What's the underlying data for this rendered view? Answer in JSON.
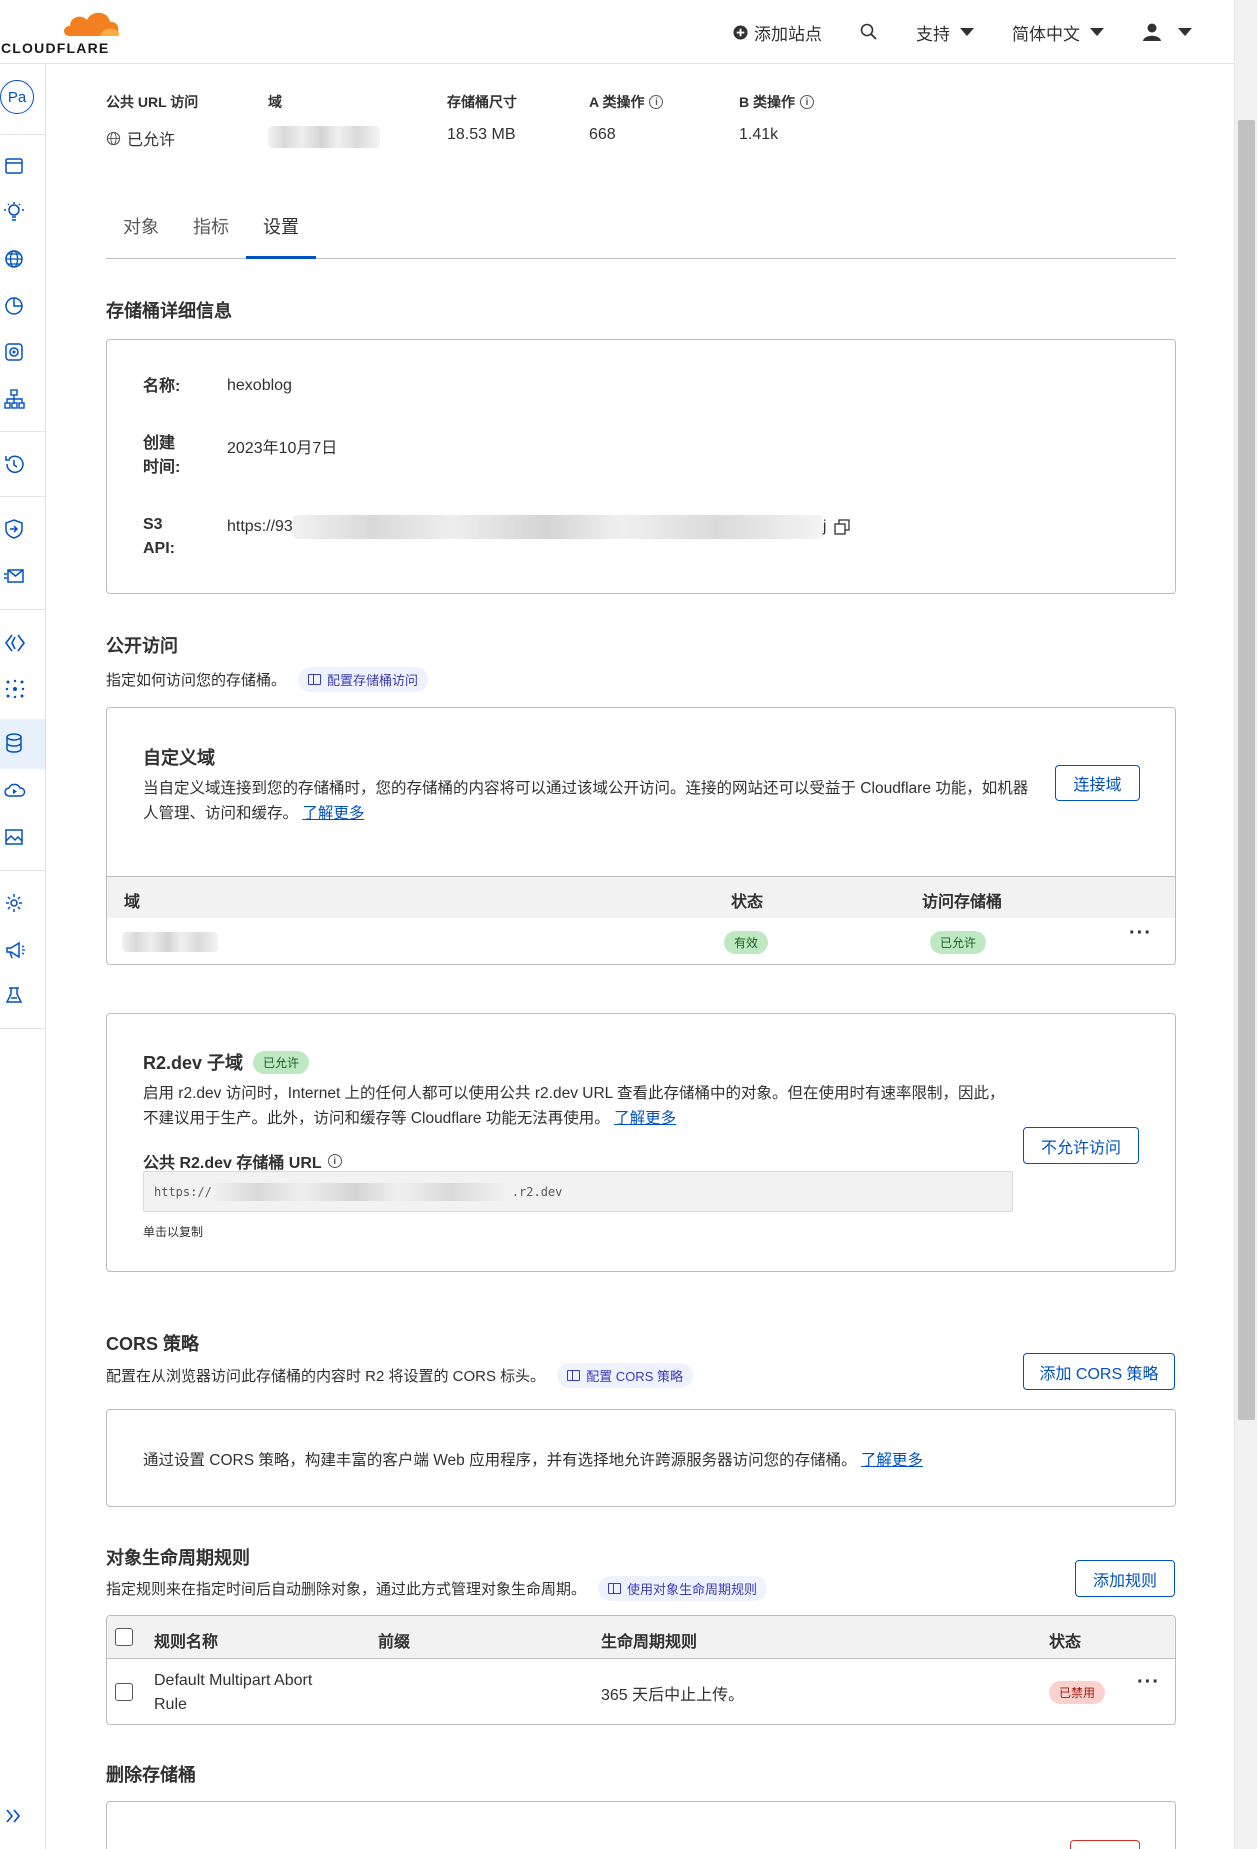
{
  "header": {
    "logo_text": "CLOUDFLARE",
    "add_site": "添加站点",
    "support": "支持",
    "language": "简体中文"
  },
  "sidebar": {
    "avatar": "Pa"
  },
  "bucket_stats": {
    "public_url_label": "公共 URL 访问",
    "public_url_value": "已允许",
    "domain_label": "域",
    "size_label": "存储桶尺寸",
    "size_value": "18.53 MB",
    "class_a_label": "A 类操作",
    "class_a_value": "668",
    "class_b_label": "B 类操作",
    "class_b_value": "1.41k"
  },
  "tabs": [
    "对象",
    "指标",
    "设置"
  ],
  "details": {
    "title": "存储桶详细信息",
    "name_label": "名称:",
    "name_value": "hexoblog",
    "created_label": "创建时间:",
    "created_value": "2023年10月7日",
    "s3_label": "S3 API:",
    "s3_value": "https://93",
    "s3_suffix": "j"
  },
  "public_access": {
    "title": "公开访问",
    "desc": "指定如何访问您的存储桶。",
    "doc_link": "配置存储桶访问",
    "custom_domain": {
      "title": "自定义域",
      "desc": "当自定义域连接到您的存储桶时，您的存储桶的内容将可以通过该域公开访问。连接的网站还可以受益于 Cloudflare 功能，如机器人管理、访问和缓存。",
      "learn_more": "了解更多",
      "connect_button": "连接域",
      "col_domain": "域",
      "col_status": "状态",
      "col_access": "访问存储桶",
      "row_status": "有效",
      "row_access": "已允许"
    },
    "r2dev": {
      "title": "R2.dev 子域",
      "badge": "已允许",
      "desc": "启用 r2.dev 访问时，Internet 上的任何人都可以使用公共 r2.dev URL 查看此存储桶中的对象。但在使用时有速率限制，因此，不建议用于生产。此外，访问和缓存等 Cloudflare 功能无法再使用。",
      "learn_more": "了解更多",
      "disallow_button": "不允许访问",
      "url_label": "公共 R2.dev 存储桶 URL",
      "url_prefix": "https://",
      "url_suffix": ".r2.dev",
      "copy_hint": "单击以复制"
    }
  },
  "cors": {
    "title": "CORS 策略",
    "desc": "配置在从浏览器访问此存储桶的内容时 R2 将设置的 CORS 标头。",
    "doc_link": "配置 CORS 策略",
    "add_button": "添加 CORS 策略",
    "empty_text": "通过设置 CORS 策略，构建丰富的客户端 Web 应用程序，并有选择地允许跨源服务器访问您的存储桶。",
    "learn_more": "了解更多"
  },
  "lifecycle": {
    "title": "对象生命周期规则",
    "desc": "指定规则来在指定时间后自动删除对象，通过此方式管理对象生命周期。",
    "doc_link": "使用对象生命周期规则",
    "add_button": "添加规则",
    "col_name": "规则名称",
    "col_prefix": "前缀",
    "col_rule": "生命周期规则",
    "col_status": "状态",
    "rows": [
      {
        "name": "Default Multipart Abort Rule",
        "rule": "365 天后中止上传。",
        "status": "已禁用"
      }
    ]
  },
  "delete": {
    "title": "删除存储桶"
  }
}
